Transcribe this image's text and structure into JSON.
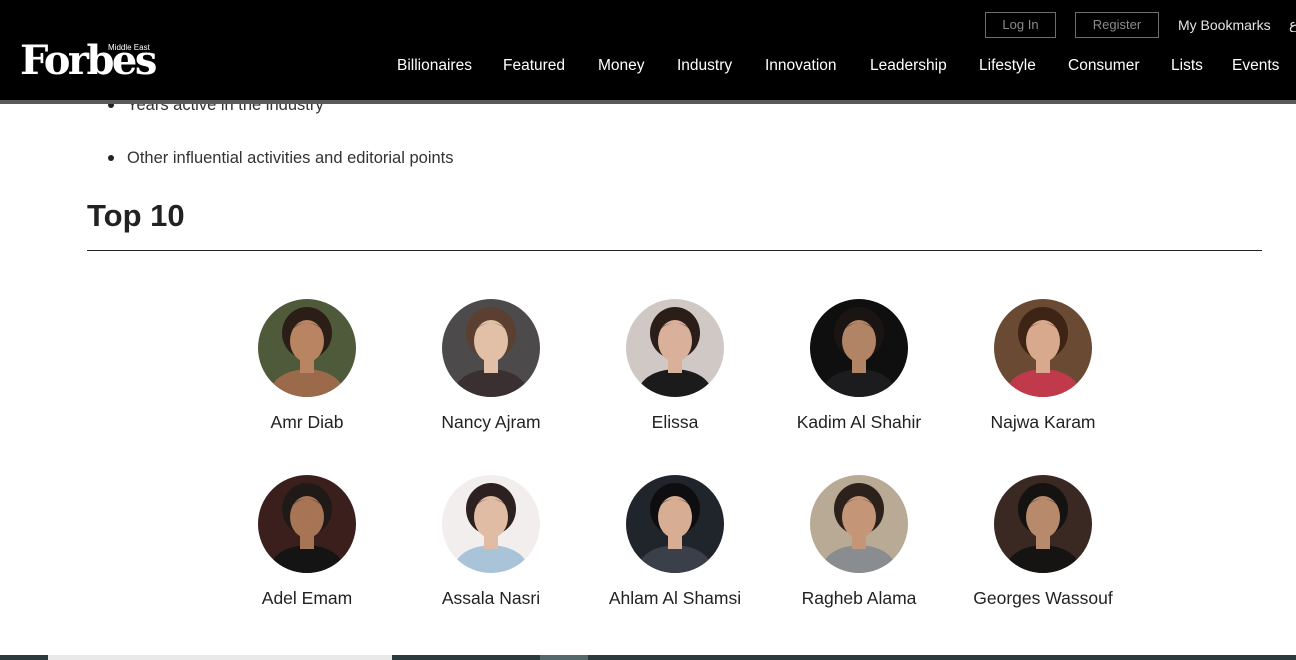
{
  "header": {
    "logo": "Forbes",
    "logo_sub": "Middle East",
    "login_label": "Log In",
    "register_label": "Register",
    "bookmarks_label": "My Bookmarks",
    "cut_glyph": "ع",
    "nav": [
      "Billionaires",
      "Featured",
      "Money",
      "Industry",
      "Innovation",
      "Leadership",
      "Lifestyle",
      "Consumer",
      "Lists",
      "Events"
    ]
  },
  "article": {
    "bullets": [
      "Years active in the industry",
      "Other influential activities and editorial points"
    ],
    "section_title": "Top 10"
  },
  "celebrities": [
    {
      "name": "Amr Diab",
      "bg": "#4e5a3a",
      "skin": "#b98462",
      "hair": "#2a1e17",
      "top": "#9a6a4a"
    },
    {
      "name": "Nancy Ajram",
      "bg": "#4d4a4c",
      "skin": "#e2c0a8",
      "hair": "#5b4032",
      "top": "#3a3032"
    },
    {
      "name": "Elissa",
      "bg": "#cfc8c5",
      "skin": "#d9b09a",
      "hair": "#2b1d18",
      "top": "#1b1b1b"
    },
    {
      "name": "Kadim Al Shahir",
      "bg": "#0f0f0f",
      "skin": "#b28466",
      "hair": "#1a1512",
      "top": "#1c1c1e"
    },
    {
      "name": "Najwa Karam",
      "bg": "#6b4a34",
      "skin": "#d8a98c",
      "hair": "#3e2414",
      "top": "#c03a4c"
    },
    {
      "name": "Adel Emam",
      "bg": "#3a1f1c",
      "skin": "#a77456",
      "hair": "#1f1a18",
      "top": "#141414"
    },
    {
      "name": "Assala Nasri",
      "bg": "#f2eeee",
      "skin": "#e0bca5",
      "hair": "#2d2020",
      "top": "#a9c3d9"
    },
    {
      "name": "Ahlam Al Shamsi",
      "bg": "#20242b",
      "skin": "#d7ae93",
      "hair": "#0e0d10",
      "top": "#3b3f4a"
    },
    {
      "name": "Ragheb Alama",
      "bg": "#b8aa95",
      "skin": "#c59578",
      "hair": "#2c211b",
      "top": "#8a8d90"
    },
    {
      "name": "Georges Wassouf",
      "bg": "#3a2822",
      "skin": "#b88a6c",
      "hair": "#151212",
      "top": "#161412"
    }
  ]
}
